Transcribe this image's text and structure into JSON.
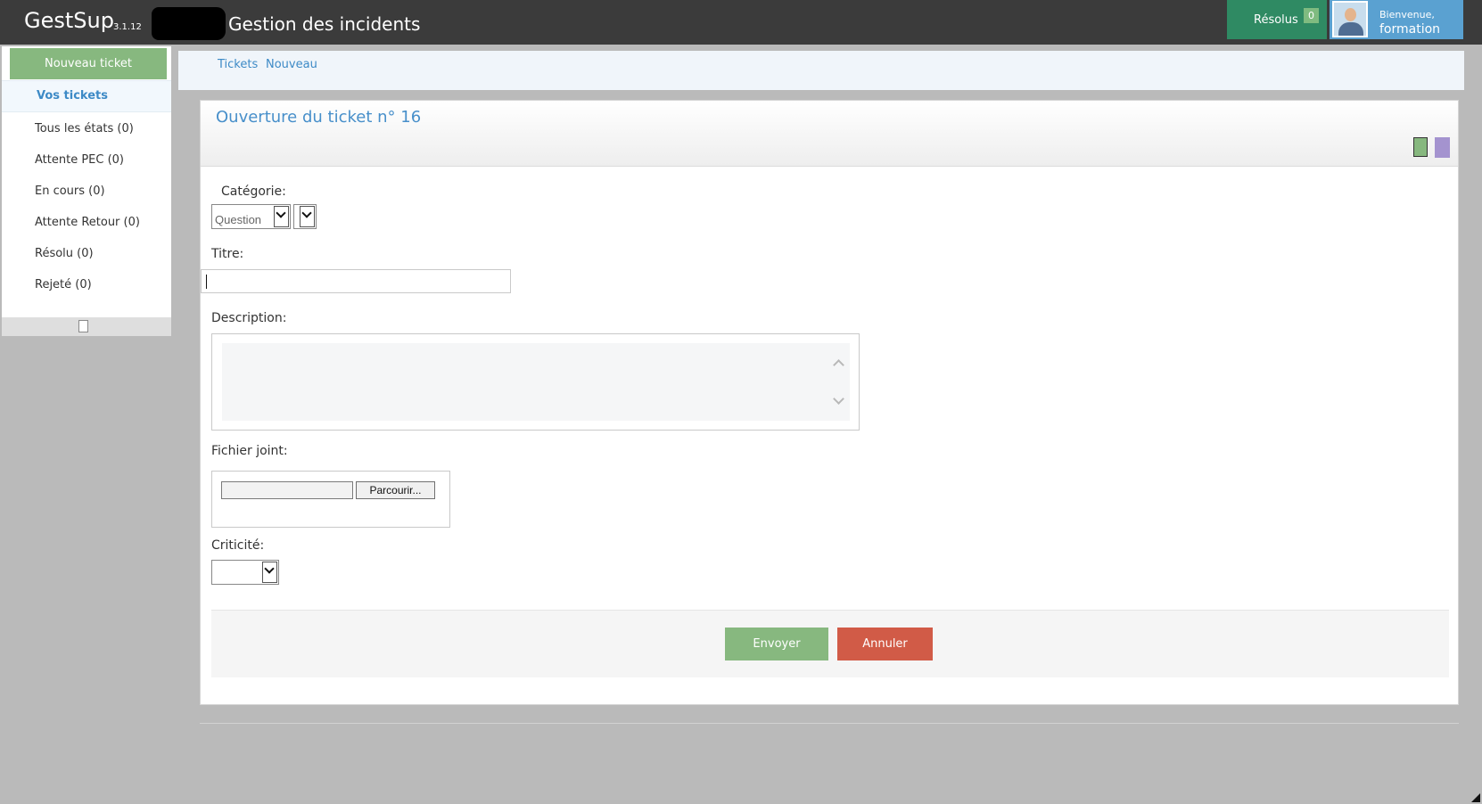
{
  "header": {
    "app_name": "GestSup",
    "version": "3.1.12",
    "title": "Gestion des incidents",
    "resolved": {
      "label": "Résolus",
      "count": "0"
    },
    "user": {
      "welcome": "Bienvenue,",
      "name": "formation"
    }
  },
  "sidebar": {
    "new_ticket_label": "Nouveau ticket",
    "active_item": "Vos tickets",
    "items": [
      {
        "label": "Tous les états (0)"
      },
      {
        "label": "Attente PEC (0)"
      },
      {
        "label": "En cours (0)"
      },
      {
        "label": "Attente Retour (0)"
      },
      {
        "label": "Résolu (0)"
      },
      {
        "label": "Rejeté (0)"
      }
    ]
  },
  "breadcrumb": [
    "Tickets",
    "Nouveau"
  ],
  "form": {
    "title": "Ouverture du ticket n° 16",
    "swatches": {
      "green": "#87b87f",
      "purple": "#a493cf"
    },
    "category_label": "Catégorie:",
    "category_value": "Question",
    "subcategory_value": "",
    "title_label": "Titre:",
    "title_value": "",
    "description_label": "Description:",
    "attachment_label": "Fichier joint:",
    "browse_label": "Parcourir...",
    "criticality_label": "Criticité:",
    "criticality_value": "",
    "send_label": "Envoyer",
    "cancel_label": "Annuler"
  },
  "colors": {
    "topbar": "#3b3b3b",
    "resolved_bg": "#2f8a63",
    "user_bg": "#5aa1d1",
    "accent_blue": "#478fca",
    "send_green": "#87b87f",
    "cancel_red": "#d15b47"
  }
}
